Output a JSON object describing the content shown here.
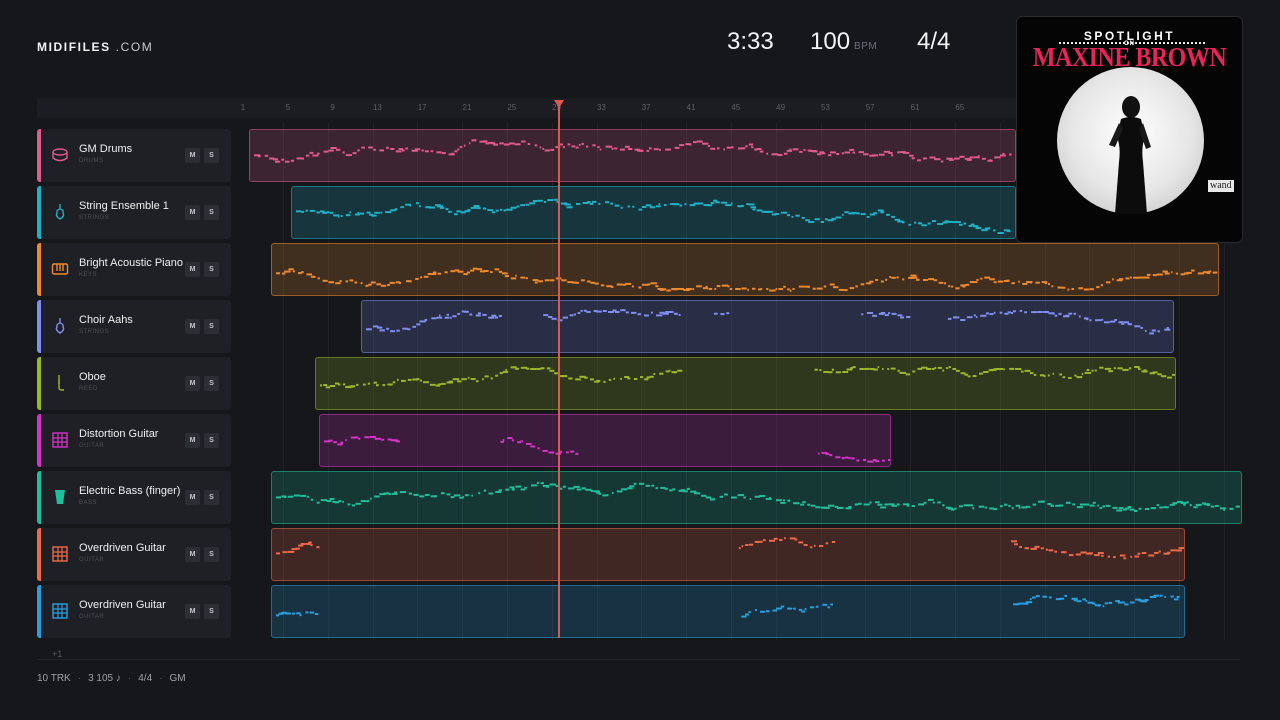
{
  "header": {
    "logo_bold": "MIDIFILES",
    "logo_rest": ".COM",
    "duration": "3:33",
    "tempo": "100",
    "tempo_unit": "BPM",
    "time_signature": "4/4"
  },
  "ruler": {
    "bars": [
      "1",
      "5",
      "9",
      "13",
      "17",
      "21",
      "25",
      "29",
      "33",
      "37",
      "41",
      "45",
      "49",
      "53",
      "57",
      "61",
      "65"
    ]
  },
  "tracks": [
    {
      "name": "GM Drums",
      "category": "DRUMS",
      "color": "#e05a8a",
      "icon": "drum-icon",
      "mute": "M",
      "solo": "S"
    },
    {
      "name": "String Ensemble 1",
      "category": "STRINGS",
      "color": "#1fb1c6",
      "icon": "violin-icon",
      "mute": "M",
      "solo": "S"
    },
    {
      "name": "Bright Acoustic Piano",
      "category": "KEYS",
      "color": "#ef8a2c",
      "icon": "piano-icon",
      "mute": "M",
      "solo": "S"
    },
    {
      "name": "Choir Aahs",
      "category": "STRINGS",
      "color": "#7f8ef0",
      "icon": "violin-icon",
      "mute": "M",
      "solo": "S"
    },
    {
      "name": "Oboe",
      "category": "REED",
      "color": "#9ab82a",
      "icon": "reed-icon",
      "mute": "M",
      "solo": "S"
    },
    {
      "name": "Distortion Guitar",
      "category": "GUITAR",
      "color": "#d633c9",
      "icon": "guitar-grid-icon",
      "mute": "M",
      "solo": "S"
    },
    {
      "name": "Electric Bass (finger)",
      "category": "BASS",
      "color": "#1fbf9b",
      "icon": "bass-icon",
      "mute": "M",
      "solo": "S"
    },
    {
      "name": "Overdriven Guitar",
      "category": "GUITAR",
      "color": "#ef6848",
      "icon": "guitar-grid-icon",
      "mute": "M",
      "solo": "S"
    },
    {
      "name": "Overdriven Guitar",
      "category": "GUITAR",
      "color": "#2a9fe0",
      "icon": "guitar-grid-icon",
      "mute": "M",
      "solo": "S"
    }
  ],
  "more_tracks": "+1",
  "footer": {
    "tracks": "10 TRK",
    "notes": "3 105 ♪",
    "signature": "4/4",
    "standard": "GM"
  },
  "cover": {
    "line1": "SPOTLIGHT",
    "line2": "ON",
    "artist": "MAXINE BROWN",
    "label": "wand"
  }
}
